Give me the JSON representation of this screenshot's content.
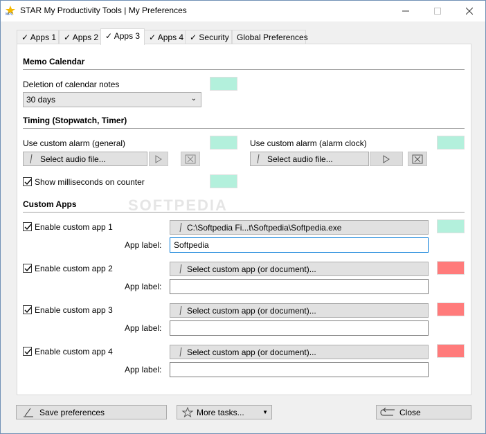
{
  "window": {
    "title": "STAR My Productivity Tools | My Preferences"
  },
  "tabs": [
    {
      "label": "Apps 1"
    },
    {
      "label": "Apps 2"
    },
    {
      "label": "Apps 3"
    },
    {
      "label": "Apps 4"
    },
    {
      "label": "Security"
    },
    {
      "label": "Global Preferences"
    }
  ],
  "active_tab": "Apps 3",
  "memo_calendar": {
    "title": "Memo Calendar",
    "deletion_label": "Deletion of calendar notes",
    "deletion_value": "30 days",
    "swatch_color": "#b3f0dc"
  },
  "timing": {
    "title": "Timing (Stopwatch, Timer)",
    "alarm_general_label": "Use custom alarm (general)",
    "alarm_clock_label": "Use custom alarm (alarm clock)",
    "select_audio_label": "Select audio file...",
    "show_ms_label": "Show milliseconds on counter"
  },
  "custom_apps": {
    "title": "Custom Apps",
    "app_label_caption": "App label:",
    "items": [
      {
        "enable_label": "Enable custom app 1",
        "path": "C:\\Softpedia Fi...t\\Softpedia\\Softpedia.exe",
        "label_value": "Softpedia",
        "color": "#b3f0dc"
      },
      {
        "enable_label": "Enable custom app 2",
        "path": "Select custom app (or document)...",
        "label_value": "",
        "color": "#ff7b7b"
      },
      {
        "enable_label": "Enable custom app 3",
        "path": "Select custom app (or document)...",
        "label_value": "",
        "color": "#ff7b7b"
      },
      {
        "enable_label": "Enable custom app 4",
        "path": "Select custom app (or document)...",
        "label_value": "",
        "color": "#ff7b7b"
      }
    ]
  },
  "footer": {
    "save_label": "Save preferences",
    "more_tasks_label": "More tasks...",
    "close_label": "Close"
  },
  "watermark": "SOFTPEDIA",
  "colors": {
    "mint": "#b3f0dc",
    "red": "#ff7b7b",
    "focus": "#0078d7"
  }
}
